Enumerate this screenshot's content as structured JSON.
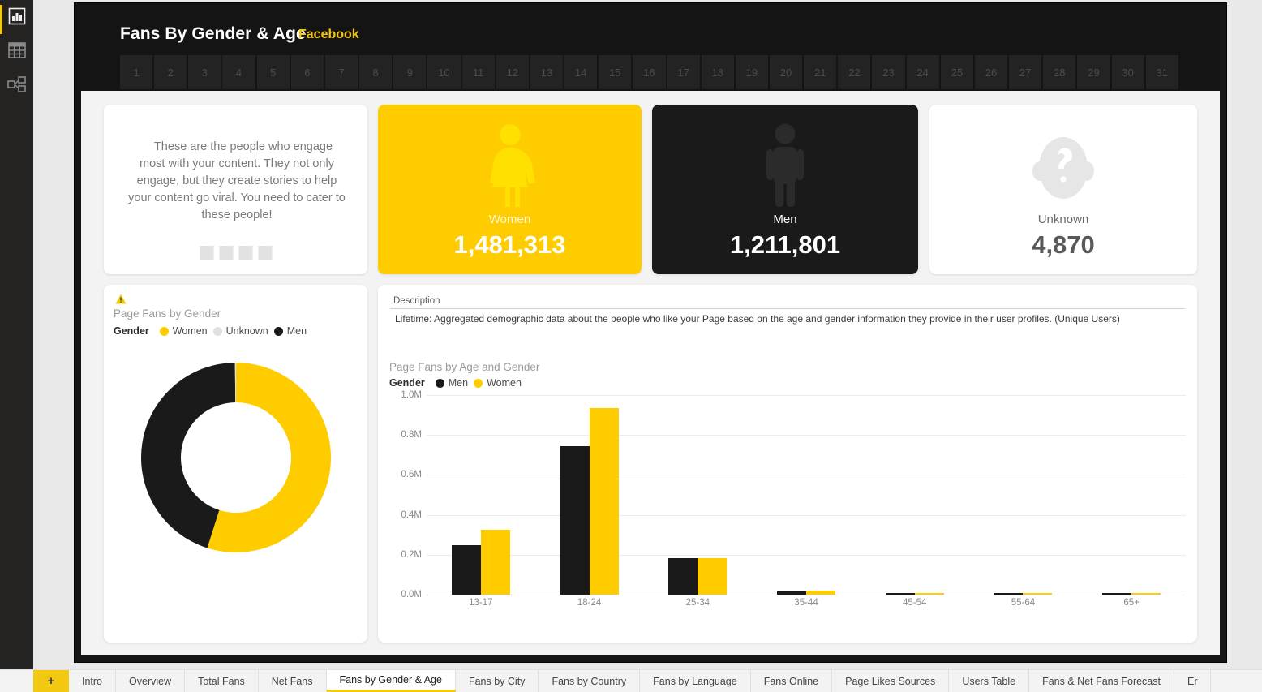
{
  "sidebar": {
    "items": [
      {
        "name": "report-view",
        "icon": "report-chart-icon"
      },
      {
        "name": "data-view",
        "icon": "table-grid-icon"
      },
      {
        "name": "model-view",
        "icon": "relationships-icon"
      }
    ]
  },
  "header": {
    "title": "Fans By Gender & Age",
    "subtitle": "Facebook",
    "days": [
      "1",
      "2",
      "3",
      "4",
      "5",
      "6",
      "7",
      "8",
      "9",
      "10",
      "11",
      "12",
      "13",
      "14",
      "15",
      "16",
      "17",
      "18",
      "19",
      "20",
      "21",
      "22",
      "23",
      "24",
      "25",
      "26",
      "27",
      "28",
      "29",
      "30",
      "31"
    ]
  },
  "info_card": {
    "text": "These are the people who engage most with your content. They not only engage, but they create stories to help your content go viral. You need to cater to these people!",
    "dots": 4
  },
  "kpis": [
    {
      "label": "Women",
      "value": "1,481,313",
      "icon": "woman-figure-icon",
      "bg": "#ffcc00",
      "fg": "#ffffff"
    },
    {
      "label": "Men",
      "value": "1,211,801",
      "icon": "man-figure-icon",
      "bg": "#1a1a1a",
      "fg": "#ffffff"
    },
    {
      "label": "Unknown",
      "value": "4,870",
      "icon": "question-head-icon",
      "bg": "#ffffff",
      "fg": "#595959"
    }
  ],
  "donut_card": {
    "warning_icon": "warning-triangle-icon",
    "title": "Page Fans by Gender",
    "legend_title": "Gender",
    "legend": [
      {
        "label": "Women",
        "color": "#ffcc00"
      },
      {
        "label": "Unknown",
        "color": "#e0e0e0"
      },
      {
        "label": "Men",
        "color": "#1a1a1a"
      }
    ]
  },
  "description": {
    "label": "Description",
    "text": "Lifetime: Aggregated demographic data about the people who like your Page based on the age and gender information they provide in their user profiles. (Unique Users)"
  },
  "chart_card": {
    "title": "Page Fans by Age and Gender",
    "legend_title": "Gender",
    "legend": [
      {
        "label": "Men",
        "color": "#1a1a1a"
      },
      {
        "label": "Women",
        "color": "#ffcc00"
      }
    ]
  },
  "chart_data": {
    "type": "bar",
    "title": "Page Fans by Age and Gender",
    "xlabel": "",
    "ylabel": "",
    "categories": [
      "13-17",
      "18-24",
      "25-34",
      "35-44",
      "45-54",
      "55-64",
      "65+"
    ],
    "series": [
      {
        "name": "Men",
        "color": "#1a1a1a",
        "values": [
          250000,
          745000,
          185000,
          18000,
          4000,
          4000,
          4000
        ]
      },
      {
        "name": "Women",
        "color": "#ffcc00",
        "values": [
          325000,
          935000,
          182000,
          20000,
          6000,
          5000,
          5000
        ]
      }
    ],
    "ylim": [
      0,
      1000000
    ],
    "yticks": [
      0,
      200000,
      400000,
      600000,
      800000,
      1000000
    ],
    "ytick_labels": [
      "0.0M",
      "0.2M",
      "0.4M",
      "0.6M",
      "0.8M",
      "1.0M"
    ],
    "grid": true,
    "legend_position": "top-left"
  },
  "donut_data": {
    "type": "pie",
    "title": "Page Fans by Gender",
    "categories": [
      "Women",
      "Men",
      "Unknown"
    ],
    "values": [
      1481313,
      1211801,
      4870
    ],
    "colors": [
      "#ffcc00",
      "#1a1a1a",
      "#e0e0e0"
    ],
    "donut": true
  },
  "tabbar": {
    "add_label": "+",
    "tabs": [
      {
        "label": "Intro",
        "active": false
      },
      {
        "label": "Overview",
        "active": false
      },
      {
        "label": "Total Fans",
        "active": false
      },
      {
        "label": "Net Fans",
        "active": false
      },
      {
        "label": "Fans by Gender & Age",
        "active": true
      },
      {
        "label": "Fans by City",
        "active": false
      },
      {
        "label": "Fans by Country",
        "active": false
      },
      {
        "label": "Fans by Language",
        "active": false
      },
      {
        "label": "Fans Online",
        "active": false
      },
      {
        "label": "Page Likes Sources",
        "active": false
      },
      {
        "label": "Users Table",
        "active": false
      },
      {
        "label": "Fans & Net Fans Forecast",
        "active": false
      },
      {
        "label": "Er",
        "active": false
      }
    ]
  },
  "colors": {
    "accent": "#f2c811",
    "yellow": "#ffcc00",
    "dark": "#1a1a1a",
    "canvas_dark": "#141414"
  }
}
